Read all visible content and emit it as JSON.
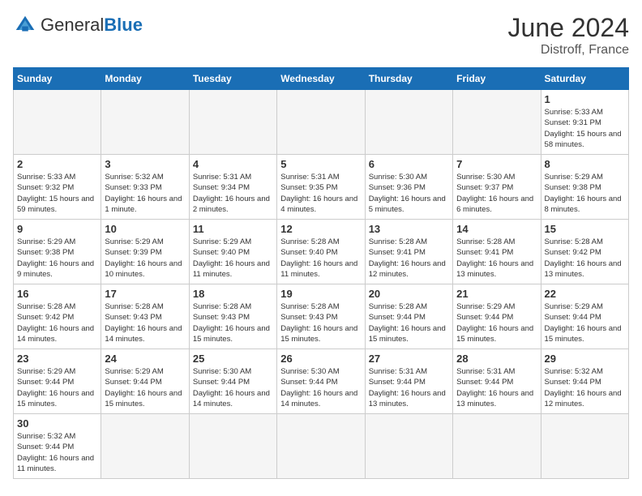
{
  "header": {
    "logo_general": "General",
    "logo_blue": "Blue",
    "title": "June 2024",
    "subtitle": "Distroff, France"
  },
  "days_of_week": [
    "Sunday",
    "Monday",
    "Tuesday",
    "Wednesday",
    "Thursday",
    "Friday",
    "Saturday"
  ],
  "weeks": [
    {
      "days": [
        {
          "number": "",
          "info": "",
          "empty": true
        },
        {
          "number": "",
          "info": "",
          "empty": true
        },
        {
          "number": "",
          "info": "",
          "empty": true
        },
        {
          "number": "",
          "info": "",
          "empty": true
        },
        {
          "number": "",
          "info": "",
          "empty": true
        },
        {
          "number": "",
          "info": "",
          "empty": true
        },
        {
          "number": "1",
          "info": "Sunrise: 5:33 AM\nSunset: 9:31 PM\nDaylight: 15 hours\nand 58 minutes.",
          "empty": false
        }
      ]
    },
    {
      "days": [
        {
          "number": "2",
          "info": "Sunrise: 5:33 AM\nSunset: 9:32 PM\nDaylight: 15 hours\nand 59 minutes.",
          "empty": false
        },
        {
          "number": "3",
          "info": "Sunrise: 5:32 AM\nSunset: 9:33 PM\nDaylight: 16 hours\nand 1 minute.",
          "empty": false
        },
        {
          "number": "4",
          "info": "Sunrise: 5:31 AM\nSunset: 9:34 PM\nDaylight: 16 hours\nand 2 minutes.",
          "empty": false
        },
        {
          "number": "5",
          "info": "Sunrise: 5:31 AM\nSunset: 9:35 PM\nDaylight: 16 hours\nand 4 minutes.",
          "empty": false
        },
        {
          "number": "6",
          "info": "Sunrise: 5:30 AM\nSunset: 9:36 PM\nDaylight: 16 hours\nand 5 minutes.",
          "empty": false
        },
        {
          "number": "7",
          "info": "Sunrise: 5:30 AM\nSunset: 9:37 PM\nDaylight: 16 hours\nand 6 minutes.",
          "empty": false
        },
        {
          "number": "8",
          "info": "Sunrise: 5:29 AM\nSunset: 9:38 PM\nDaylight: 16 hours\nand 8 minutes.",
          "empty": false
        }
      ]
    },
    {
      "days": [
        {
          "number": "9",
          "info": "Sunrise: 5:29 AM\nSunset: 9:38 PM\nDaylight: 16 hours\nand 9 minutes.",
          "empty": false
        },
        {
          "number": "10",
          "info": "Sunrise: 5:29 AM\nSunset: 9:39 PM\nDaylight: 16 hours\nand 10 minutes.",
          "empty": false
        },
        {
          "number": "11",
          "info": "Sunrise: 5:29 AM\nSunset: 9:40 PM\nDaylight: 16 hours\nand 11 minutes.",
          "empty": false
        },
        {
          "number": "12",
          "info": "Sunrise: 5:28 AM\nSunset: 9:40 PM\nDaylight: 16 hours\nand 11 minutes.",
          "empty": false
        },
        {
          "number": "13",
          "info": "Sunrise: 5:28 AM\nSunset: 9:41 PM\nDaylight: 16 hours\nand 12 minutes.",
          "empty": false
        },
        {
          "number": "14",
          "info": "Sunrise: 5:28 AM\nSunset: 9:41 PM\nDaylight: 16 hours\nand 13 minutes.",
          "empty": false
        },
        {
          "number": "15",
          "info": "Sunrise: 5:28 AM\nSunset: 9:42 PM\nDaylight: 16 hours\nand 13 minutes.",
          "empty": false
        }
      ]
    },
    {
      "days": [
        {
          "number": "16",
          "info": "Sunrise: 5:28 AM\nSunset: 9:42 PM\nDaylight: 16 hours\nand 14 minutes.",
          "empty": false
        },
        {
          "number": "17",
          "info": "Sunrise: 5:28 AM\nSunset: 9:43 PM\nDaylight: 16 hours\nand 14 minutes.",
          "empty": false
        },
        {
          "number": "18",
          "info": "Sunrise: 5:28 AM\nSunset: 9:43 PM\nDaylight: 16 hours\nand 15 minutes.",
          "empty": false
        },
        {
          "number": "19",
          "info": "Sunrise: 5:28 AM\nSunset: 9:43 PM\nDaylight: 16 hours\nand 15 minutes.",
          "empty": false
        },
        {
          "number": "20",
          "info": "Sunrise: 5:28 AM\nSunset: 9:44 PM\nDaylight: 16 hours\nand 15 minutes.",
          "empty": false
        },
        {
          "number": "21",
          "info": "Sunrise: 5:29 AM\nSunset: 9:44 PM\nDaylight: 16 hours\nand 15 minutes.",
          "empty": false
        },
        {
          "number": "22",
          "info": "Sunrise: 5:29 AM\nSunset: 9:44 PM\nDaylight: 16 hours\nand 15 minutes.",
          "empty": false
        }
      ]
    },
    {
      "days": [
        {
          "number": "23",
          "info": "Sunrise: 5:29 AM\nSunset: 9:44 PM\nDaylight: 16 hours\nand 15 minutes.",
          "empty": false
        },
        {
          "number": "24",
          "info": "Sunrise: 5:29 AM\nSunset: 9:44 PM\nDaylight: 16 hours\nand 15 minutes.",
          "empty": false
        },
        {
          "number": "25",
          "info": "Sunrise: 5:30 AM\nSunset: 9:44 PM\nDaylight: 16 hours\nand 14 minutes.",
          "empty": false
        },
        {
          "number": "26",
          "info": "Sunrise: 5:30 AM\nSunset: 9:44 PM\nDaylight: 16 hours\nand 14 minutes.",
          "empty": false
        },
        {
          "number": "27",
          "info": "Sunrise: 5:31 AM\nSunset: 9:44 PM\nDaylight: 16 hours\nand 13 minutes.",
          "empty": false
        },
        {
          "number": "28",
          "info": "Sunrise: 5:31 AM\nSunset: 9:44 PM\nDaylight: 16 hours\nand 13 minutes.",
          "empty": false
        },
        {
          "number": "29",
          "info": "Sunrise: 5:32 AM\nSunset: 9:44 PM\nDaylight: 16 hours\nand 12 minutes.",
          "empty": false
        }
      ]
    },
    {
      "days": [
        {
          "number": "30",
          "info": "Sunrise: 5:32 AM\nSunset: 9:44 PM\nDaylight: 16 hours\nand 11 minutes.",
          "empty": false
        },
        {
          "number": "",
          "info": "",
          "empty": true
        },
        {
          "number": "",
          "info": "",
          "empty": true
        },
        {
          "number": "",
          "info": "",
          "empty": true
        },
        {
          "number": "",
          "info": "",
          "empty": true
        },
        {
          "number": "",
          "info": "",
          "empty": true
        },
        {
          "number": "",
          "info": "",
          "empty": true
        }
      ]
    }
  ]
}
